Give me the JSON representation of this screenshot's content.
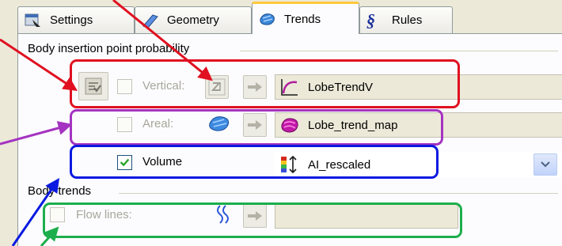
{
  "tabs": [
    {
      "label": "Settings",
      "icon": "settings-icon"
    },
    {
      "label": "Geometry",
      "icon": "geometry-icon"
    },
    {
      "label": "Trends",
      "icon": "trends-icon",
      "active": true
    },
    {
      "label": "Rules",
      "icon": "rules-icon"
    }
  ],
  "insertion_group": {
    "title": "Body insertion point probability",
    "vertical": {
      "label": "Vertical:",
      "checked": false,
      "enabled": false,
      "value": "LobeTrendV",
      "value_icon": "curve-trend-icon"
    },
    "areal": {
      "label": "Areal:",
      "checked": false,
      "enabled": false,
      "value": "Lobe_trend_map",
      "value_icon": "map-trend-icon"
    },
    "volume": {
      "label": "Volume",
      "checked": true,
      "enabled": true,
      "value": "AI_rescaled",
      "value_icon": "color-scale-icon"
    }
  },
  "body_trends_group": {
    "title": "Body trends",
    "flow_lines": {
      "label": "Flow lines:",
      "checked": false,
      "enabled": false,
      "value": ""
    }
  },
  "annotation_colors": {
    "red": "#e01020",
    "purple": "#a533c1",
    "blue": "#0a1ae0",
    "green": "#1cae4c"
  }
}
